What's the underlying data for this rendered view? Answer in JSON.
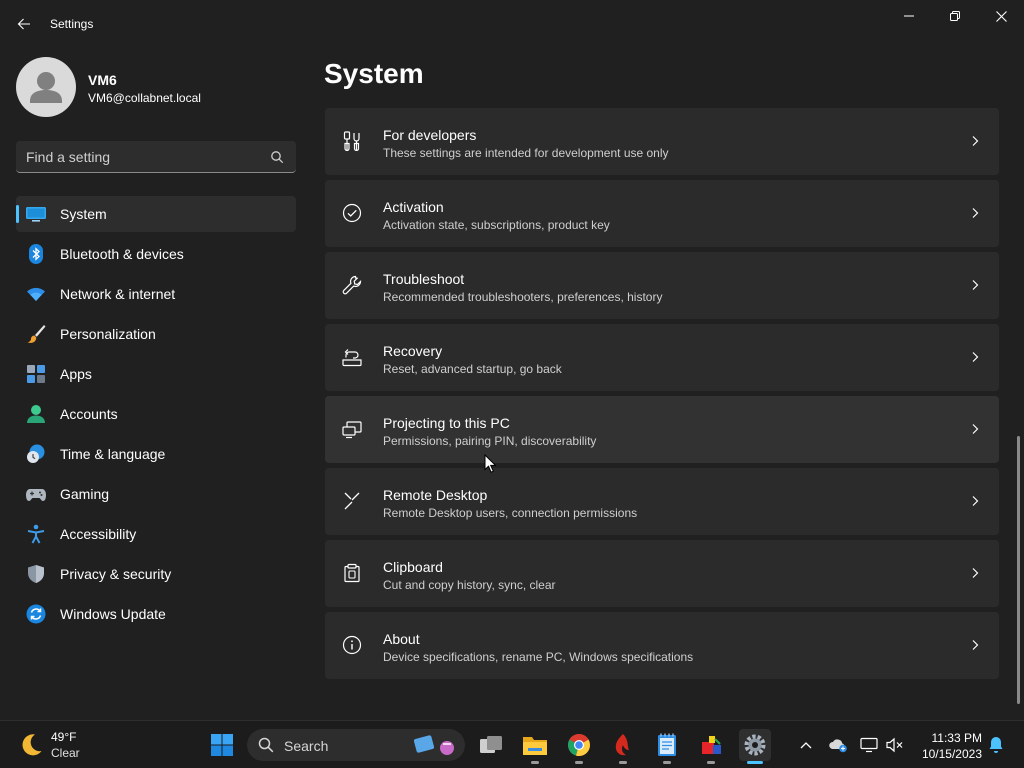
{
  "window": {
    "title": "Settings"
  },
  "user": {
    "name": "VM6",
    "email": "VM6@collabnet.local"
  },
  "search": {
    "placeholder": "Find a setting"
  },
  "nav": {
    "items": [
      {
        "label": "System",
        "icon": "system-icon",
        "active": true
      },
      {
        "label": "Bluetooth & devices",
        "icon": "bluetooth-icon"
      },
      {
        "label": "Network & internet",
        "icon": "wifi-icon"
      },
      {
        "label": "Personalization",
        "icon": "brush-icon"
      },
      {
        "label": "Apps",
        "icon": "apps-icon"
      },
      {
        "label": "Accounts",
        "icon": "accounts-icon"
      },
      {
        "label": "Time & language",
        "icon": "globe-clock-icon"
      },
      {
        "label": "Gaming",
        "icon": "controller-icon"
      },
      {
        "label": "Accessibility",
        "icon": "accessibility-icon"
      },
      {
        "label": "Privacy & security",
        "icon": "shield-icon"
      },
      {
        "label": "Windows Update",
        "icon": "update-icon"
      }
    ]
  },
  "main": {
    "title": "System",
    "cards": [
      {
        "title": "For developers",
        "desc": "These settings are intended for development use only",
        "icon": "developer-tools-icon"
      },
      {
        "title": "Activation",
        "desc": "Activation state, subscriptions, product key",
        "icon": "checkmark-circle-icon"
      },
      {
        "title": "Troubleshoot",
        "desc": "Recommended troubleshooters, preferences, history",
        "icon": "wrench-icon"
      },
      {
        "title": "Recovery",
        "desc": "Reset, advanced startup, go back",
        "icon": "recovery-icon"
      },
      {
        "title": "Projecting to this PC",
        "desc": "Permissions, pairing PIN, discoverability",
        "icon": "projector-icon"
      },
      {
        "title": "Remote Desktop",
        "desc": "Remote Desktop users, connection permissions",
        "icon": "remote-desktop-icon"
      },
      {
        "title": "Clipboard",
        "desc": "Cut and copy history, sync, clear",
        "icon": "clipboard-icon"
      },
      {
        "title": "About",
        "desc": "Device specifications, rename PC, Windows specifications",
        "icon": "info-icon"
      }
    ]
  },
  "taskbar": {
    "weather": {
      "temp": "49°F",
      "condition": "Clear",
      "icon": "moon-icon"
    },
    "search_label": "Search",
    "apps": [
      "start-icon",
      "task-view-icon",
      "file-explorer-icon",
      "chrome-icon",
      "app-red-icon",
      "notepad-icon",
      "app-icon",
      "settings-icon"
    ],
    "tray": [
      "chevron-up-icon",
      "onedrive-icon",
      "network-icon",
      "volume-muted-icon"
    ],
    "clock": {
      "time": "11:33 PM",
      "date": "10/15/2023"
    }
  },
  "colors": {
    "background": "#202020",
    "card": "#2b2b2b",
    "accent": "#4cc2ff",
    "taskbar": "#1c1c1c"
  }
}
